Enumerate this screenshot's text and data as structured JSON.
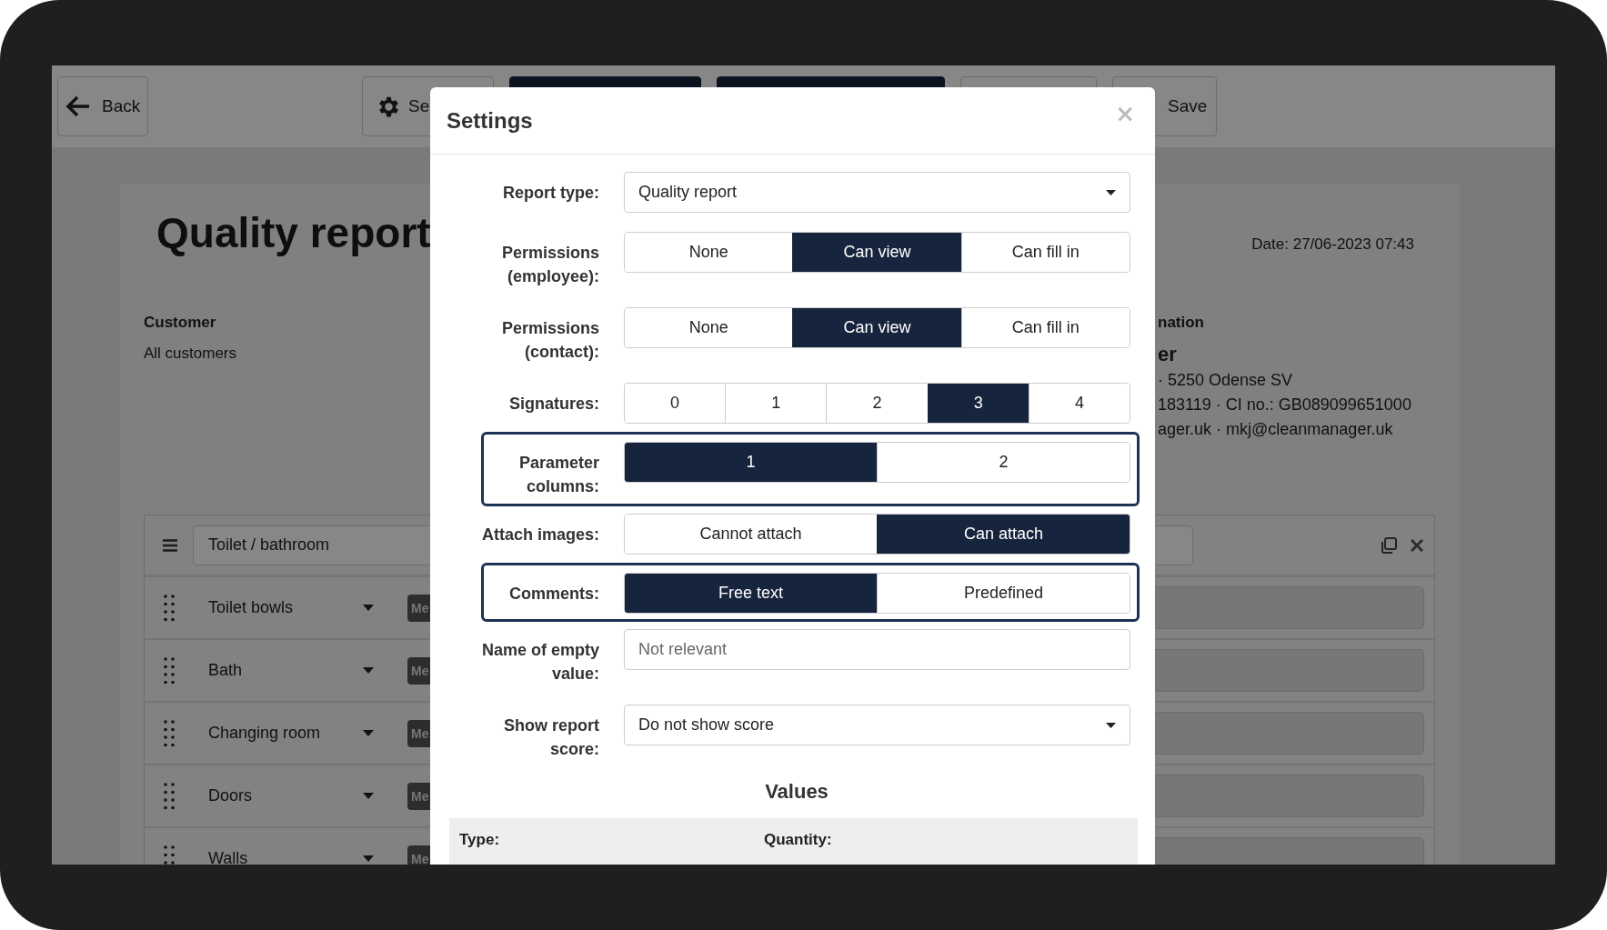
{
  "toolbar": {
    "back_button": "Back",
    "settings_button": "Se",
    "buttons": [
      {
        "kind": "dark"
      },
      {
        "kind": "dark"
      },
      {
        "kind": "light"
      }
    ],
    "save_button": "Save"
  },
  "report": {
    "title": "Quality report",
    "date": "Date: 27/06-2023 07:43",
    "customer_label": "Customer",
    "customer_value": "All customers",
    "company_heading": "nation",
    "company_name": "er",
    "company_lines": [
      "· 5250 Odense SV",
      "183119 · CI no.: GB089099651000",
      "ager.uk · mkj@cleanmanager.uk"
    ]
  },
  "section": {
    "name": "Toilet / bathroom",
    "items": [
      {
        "name": "Toilet bowls",
        "badge": "Me"
      },
      {
        "name": "Bath",
        "badge": "Me"
      },
      {
        "name": "Changing room",
        "badge": "Me"
      },
      {
        "name": "Doors",
        "badge": "Me"
      },
      {
        "name": "Walls",
        "badge": "Me"
      }
    ]
  },
  "dialog": {
    "title": "Settings",
    "close": "×",
    "fields": [
      {
        "kind": "select",
        "label": "Report type:",
        "value": "Quality report",
        "highlighted": false
      },
      {
        "kind": "segmented",
        "label": "Permissions (employee):",
        "highlighted": false,
        "options": [
          {
            "label": "None",
            "selected": false
          },
          {
            "label": "Can view",
            "selected": true
          },
          {
            "label": "Can fill in",
            "selected": false
          }
        ]
      },
      {
        "kind": "segmented",
        "label": "Permissions (contact):",
        "highlighted": false,
        "options": [
          {
            "label": "None",
            "selected": false
          },
          {
            "label": "Can view",
            "selected": true
          },
          {
            "label": "Can fill in",
            "selected": false
          }
        ]
      },
      {
        "kind": "segmented",
        "label": "Signatures:",
        "highlighted": false,
        "options": [
          {
            "label": "0",
            "selected": false
          },
          {
            "label": "1",
            "selected": false
          },
          {
            "label": "2",
            "selected": false
          },
          {
            "label": "3",
            "selected": true
          },
          {
            "label": "4",
            "selected": false
          }
        ]
      },
      {
        "kind": "segmented",
        "label": "Parameter columns:",
        "highlighted": true,
        "options": [
          {
            "label": "1",
            "selected": true
          },
          {
            "label": "2",
            "selected": false
          }
        ]
      },
      {
        "kind": "segmented",
        "label": "Attach images:",
        "highlighted": false,
        "options": [
          {
            "label": "Cannot attach",
            "selected": false
          },
          {
            "label": "Can attach",
            "selected": true
          }
        ]
      },
      {
        "kind": "segmented",
        "label": "Comments:",
        "highlighted": true,
        "options": [
          {
            "label": "Free text",
            "selected": true
          },
          {
            "label": "Predefined",
            "selected": false
          }
        ]
      },
      {
        "kind": "text",
        "label": "Name of empty value:",
        "placeholder": "Not relevant",
        "highlighted": false
      },
      {
        "kind": "select",
        "label": "Show report score:",
        "value": "Do not show score",
        "highlighted": false
      }
    ],
    "values_heading": "Values",
    "values_columns": [
      "Type:",
      "Quantity:"
    ]
  }
}
